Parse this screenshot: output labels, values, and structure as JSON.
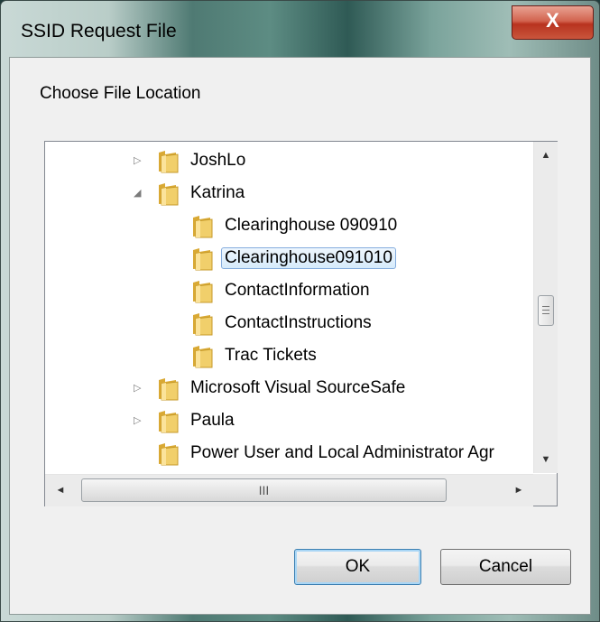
{
  "window": {
    "title": "SSID Request File",
    "close_glyph": "X"
  },
  "dialog": {
    "prompt": "Choose  File Location"
  },
  "tree": {
    "items": [
      {
        "label": "JoshLo",
        "level": 0,
        "expander": "collapsed"
      },
      {
        "label": "Katrina",
        "level": 0,
        "expander": "expanded"
      },
      {
        "label": "Clearinghouse 090910",
        "level": 1,
        "expander": "none"
      },
      {
        "label": "Clearinghouse091010",
        "level": 1,
        "expander": "none",
        "selected": true
      },
      {
        "label": "ContactInformation",
        "level": 1,
        "expander": "none"
      },
      {
        "label": "ContactInstructions",
        "level": 1,
        "expander": "none"
      },
      {
        "label": "Trac Tickets",
        "level": 1,
        "expander": "none"
      },
      {
        "label": "Microsoft Visual SourceSafe",
        "level": 0,
        "expander": "collapsed"
      },
      {
        "label": "Paula",
        "level": 0,
        "expander": "collapsed"
      },
      {
        "label": "Power User and Local Administrator Agr",
        "level": 0,
        "expander": "none"
      }
    ],
    "scroll": {
      "up": "▲",
      "down": "▼",
      "left": "◄",
      "right": "►",
      "hthumb_grip": "III"
    }
  },
  "buttons": {
    "ok": "OK",
    "cancel": "Cancel"
  },
  "colors": {
    "folder": "#e8c25a",
    "selection_border": "#84acdd",
    "close_button": "#c9553c"
  },
  "icons": {
    "folder": "folder-icon",
    "expand": "triangle-right-icon",
    "collapse": "triangle-down-icon"
  }
}
